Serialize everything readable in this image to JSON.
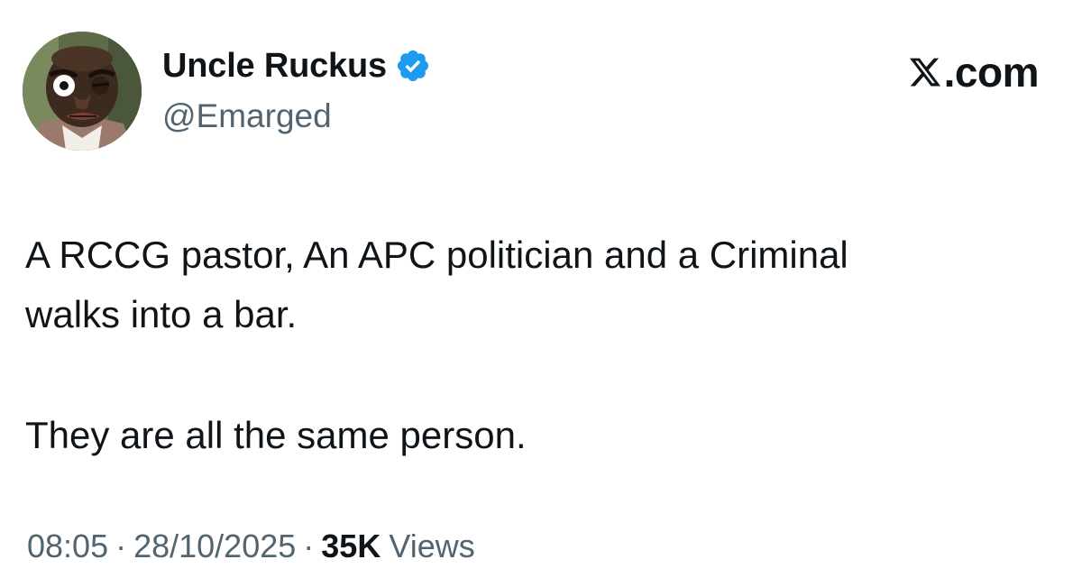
{
  "author": {
    "display_name": "Uncle Ruckus",
    "handle": "@Emarged",
    "verified": true,
    "avatar_icon": "cartoon-man-avatar"
  },
  "brand": {
    "text": ".com",
    "logo_icon": "x-logo-icon"
  },
  "tweet": {
    "paragraphs": [
      "A RCCG pastor, An APC politician and a Criminal\nwalks into a bar.",
      "They are all the same person."
    ]
  },
  "meta": {
    "time": "08:05",
    "separator": "·",
    "date": "28/10/2025",
    "views_count": "35K",
    "views_label": "Views"
  },
  "colors": {
    "text": "#0f1419",
    "secondary_text": "#536471",
    "verified_badge": "#1d9bf0",
    "background": "#ffffff"
  }
}
